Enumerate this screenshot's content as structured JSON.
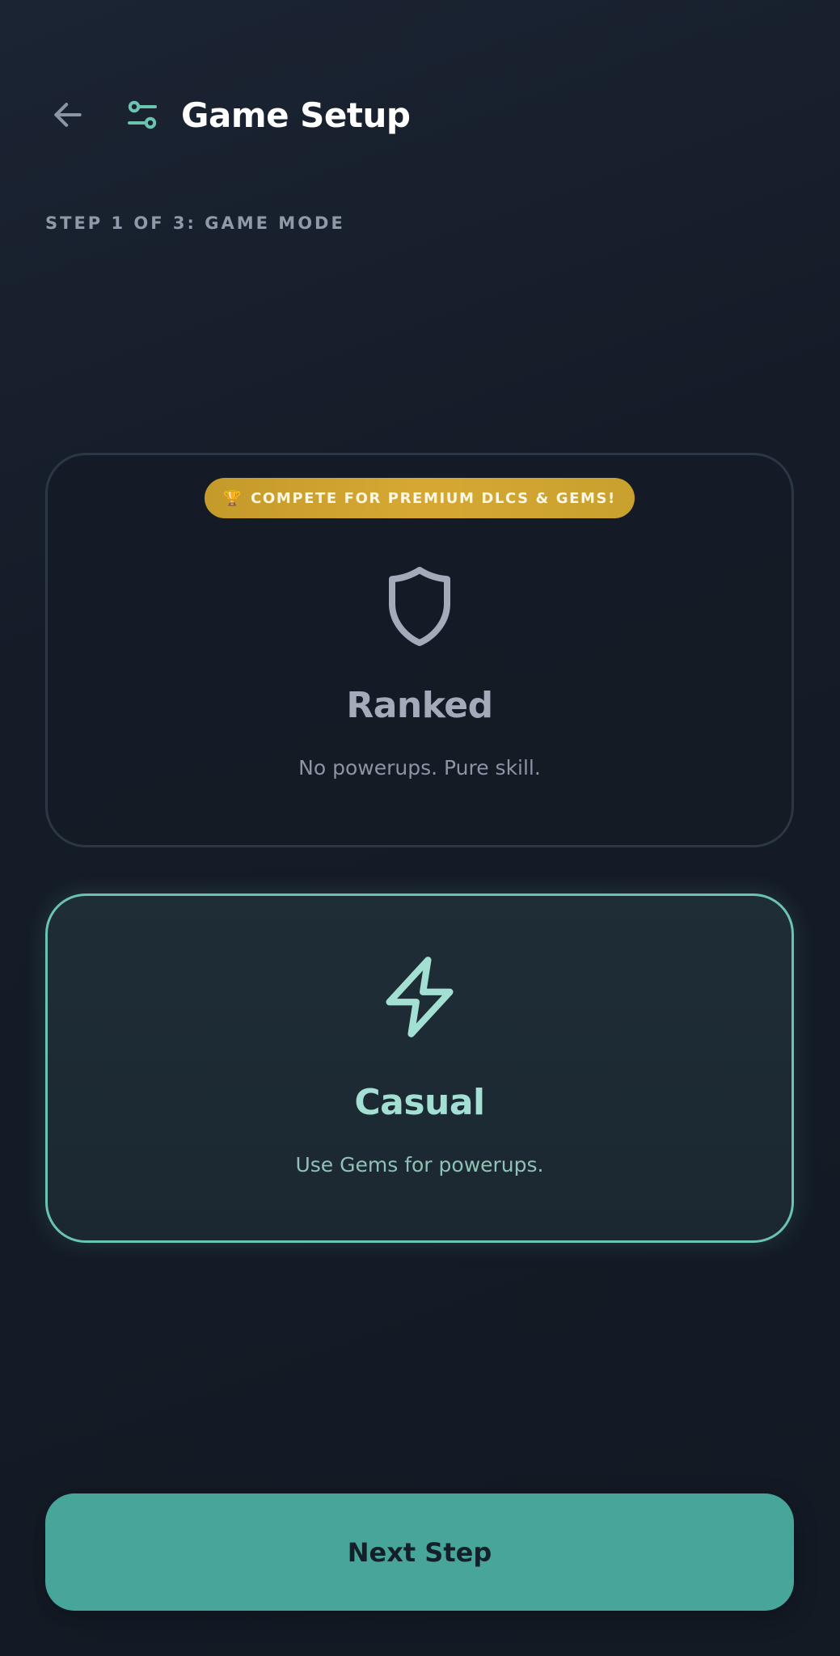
{
  "header": {
    "back_icon": "arrow-left-icon",
    "settings_icon": "sliders-icon",
    "title": "Game Setup"
  },
  "step": {
    "label": "STEP 1 OF 3: GAME MODE"
  },
  "modes": {
    "ranked": {
      "badge_icon": "🏆",
      "badge": "COMPETE FOR PREMIUM DLCS & GEMS!",
      "icon": "shield-icon",
      "title": "Ranked",
      "description": "No powerups. Pure skill.",
      "selected": false
    },
    "casual": {
      "icon": "lightning-icon",
      "title": "Casual",
      "description": "Use Gems for powerups.",
      "selected": true
    }
  },
  "footer": {
    "next_label": "Next Step"
  },
  "colors": {
    "accent": "#6bc4b0",
    "button": "#48a59a",
    "badge": "#d6a833",
    "background": "#151c28"
  }
}
